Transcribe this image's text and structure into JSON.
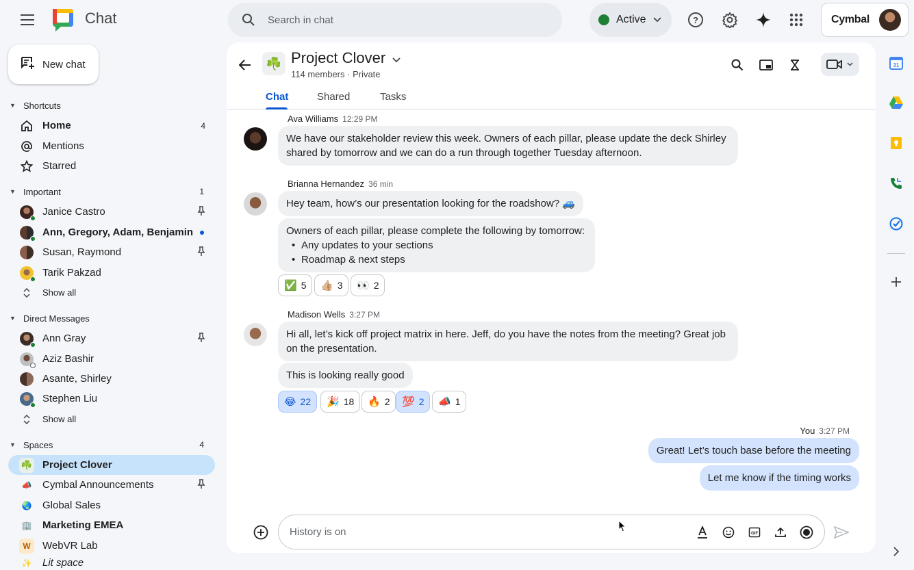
{
  "app": {
    "title": "Chat"
  },
  "search": {
    "placeholder": "Search in chat"
  },
  "status": {
    "label": "Active",
    "color": "#1e7e34"
  },
  "account": {
    "brand": "Cymbal"
  },
  "sidebar": {
    "new_chat_label": "New chat",
    "shortcuts": {
      "title": "Shortcuts",
      "items": [
        {
          "label": "Home",
          "count": "4",
          "icon": "home-icon"
        },
        {
          "label": "Mentions",
          "icon": "at-icon"
        },
        {
          "label": "Starred",
          "icon": "star-icon"
        }
      ]
    },
    "important": {
      "title": "Important",
      "count": "1",
      "items": [
        {
          "label": "Janice Castro",
          "pinned": true
        },
        {
          "label": "Ann, Gregory, Adam, Benjamin",
          "unread": true
        },
        {
          "label": "Susan, Raymond",
          "pinned": true
        },
        {
          "label": "Tarik Pakzad"
        }
      ],
      "show_all": "Show all"
    },
    "direct_messages": {
      "title": "Direct Messages",
      "items": [
        {
          "label": "Ann Gray",
          "pinned": true
        },
        {
          "label": "Aziz Bashir"
        },
        {
          "label": "Asante, Shirley"
        },
        {
          "label": "Stephen Liu"
        }
      ],
      "show_all": "Show all"
    },
    "spaces": {
      "title": "Spaces",
      "count": "4",
      "items": [
        {
          "label": "Project Clover",
          "icon": "☘️"
        },
        {
          "label": "Cymbal Announcements",
          "icon": "📣",
          "pinned": true
        },
        {
          "label": "Global Sales",
          "icon": "🌏"
        },
        {
          "label": "Marketing EMEA",
          "icon": "🏢"
        },
        {
          "label": "WebVR Lab",
          "icon": "W"
        },
        {
          "label": "Lit space",
          "icon": "✨"
        }
      ]
    }
  },
  "space": {
    "name": "Project Clover",
    "icon": "☘️",
    "meta": "114 members · Private",
    "tabs": [
      "Chat",
      "Shared",
      "Tasks"
    ]
  },
  "messages": [
    {
      "author": "Ava Williams",
      "time": "12:29 PM",
      "bubbles": [
        "We have our stakeholder review this week.  Owners of each pillar, please update the deck Shirley shared by tomorrow and we can do a run through together Tuesday afternoon."
      ]
    },
    {
      "author": "Brianna Hernandez",
      "time": "36 min",
      "bubble1": "Hey team, how’s our presentation looking for the roadshow? 🚙",
      "bubble2_intro": "Owners of each pillar, please complete the following by tomorrow:",
      "bubble2_items": [
        "Any updates to your sections",
        "Roadmap & next steps"
      ],
      "reactions": [
        {
          "emoji": "✅",
          "count": "5"
        },
        {
          "emoji": "👍🏼",
          "count": "3"
        },
        {
          "emoji": "👀",
          "count": "2"
        }
      ]
    },
    {
      "author": "Madison Wells",
      "time": "3:27 PM",
      "bubble1": "Hi all, let’s kick off project matrix in here. Jeff, do you have the notes from the meeting? Great job on the presentation.",
      "bubble2": "This is looking really good",
      "reactions": [
        {
          "emoji": "😂",
          "count": "22",
          "selected": true
        },
        {
          "emoji": "🎉",
          "count": "18"
        },
        {
          "emoji": "🔥",
          "count": "2"
        },
        {
          "emoji": "💯",
          "count": "2",
          "selected": true
        },
        {
          "emoji": "📣",
          "count": "1"
        }
      ]
    },
    {
      "author": "You",
      "time": "3:27 PM",
      "bubble1": "Great! Let’s touch base before the meeting",
      "bubble2": "Let me know if the timing works"
    }
  ],
  "composer": {
    "placeholder": "History is on"
  },
  "colors": {
    "accent": "#0b57d0",
    "active_item": "#c7e3fb",
    "my_bubble": "#d3e3fd"
  }
}
